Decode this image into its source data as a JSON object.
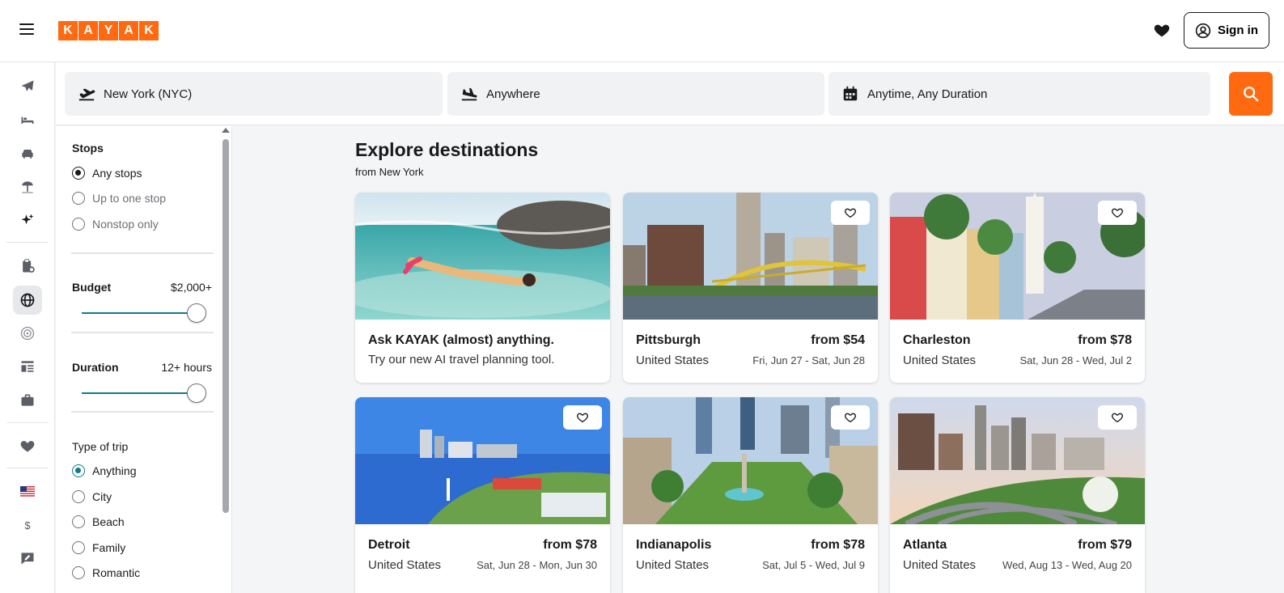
{
  "header": {
    "logo_letters": [
      "K",
      "A",
      "Y",
      "A",
      "K"
    ],
    "signin_label": "Sign in",
    "brand_color": "#ff690f"
  },
  "rail": {
    "items": [
      {
        "name": "flights",
        "icon": "plane-icon"
      },
      {
        "name": "stays",
        "icon": "bed-icon"
      },
      {
        "name": "cars",
        "icon": "car-icon"
      },
      {
        "name": "packages",
        "icon": "beach-umbrella-icon"
      },
      {
        "name": "ai",
        "icon": "sparkle-icon"
      },
      {
        "name": "trips",
        "icon": "clipboard-icon"
      },
      {
        "name": "explore",
        "icon": "globe-icon",
        "active": true
      },
      {
        "name": "flight-tracker",
        "icon": "radar-icon"
      },
      {
        "name": "direct",
        "icon": "list-icon"
      },
      {
        "name": "business",
        "icon": "briefcase-icon"
      },
      {
        "name": "saved",
        "icon": "heart-icon"
      },
      {
        "name": "language",
        "icon": "us-flag-icon"
      },
      {
        "name": "currency",
        "icon": "dollar-icon",
        "label": "$"
      },
      {
        "name": "feedback",
        "icon": "feedback-icon"
      }
    ]
  },
  "search": {
    "origin": "New York (NYC)",
    "destination": "Anywhere",
    "dates": "Anytime, Any Duration"
  },
  "filters": {
    "stops": {
      "title": "Stops",
      "options": [
        "Any stops",
        "Up to one stop",
        "Nonstop only"
      ],
      "selected": 0
    },
    "budget": {
      "title": "Budget",
      "value": "$2,000+"
    },
    "duration": {
      "title": "Duration",
      "value": "12+ hours"
    },
    "trip_type": {
      "title": "Type of trip",
      "options": [
        "Anything",
        "City",
        "Beach",
        "Family",
        "Romantic"
      ],
      "selected": 0
    }
  },
  "main": {
    "title": "Explore destinations",
    "subtitle": "from New York",
    "promo": {
      "title": "Ask KAYAK (almost) anything.",
      "desc": "Try our new AI travel planning tool."
    },
    "cards": [
      {
        "city": "Pittsburgh",
        "price": "from $54",
        "country": "United States",
        "dates": "Fri, Jun 27 - Sat, Jun 28"
      },
      {
        "city": "Charleston",
        "price": "from $78",
        "country": "United States",
        "dates": "Sat, Jun 28 - Wed, Jul 2"
      },
      {
        "city": "Detroit",
        "price": "from $78",
        "country": "United States",
        "dates": "Sat, Jun 28 - Mon, Jun 30"
      },
      {
        "city": "Indianapolis",
        "price": "from $78",
        "country": "United States",
        "dates": "Sat, Jul 5 - Wed, Jul 9"
      },
      {
        "city": "Atlanta",
        "price": "from $79",
        "country": "United States",
        "dates": "Wed, Aug 13 - Wed, Aug 20"
      }
    ]
  }
}
